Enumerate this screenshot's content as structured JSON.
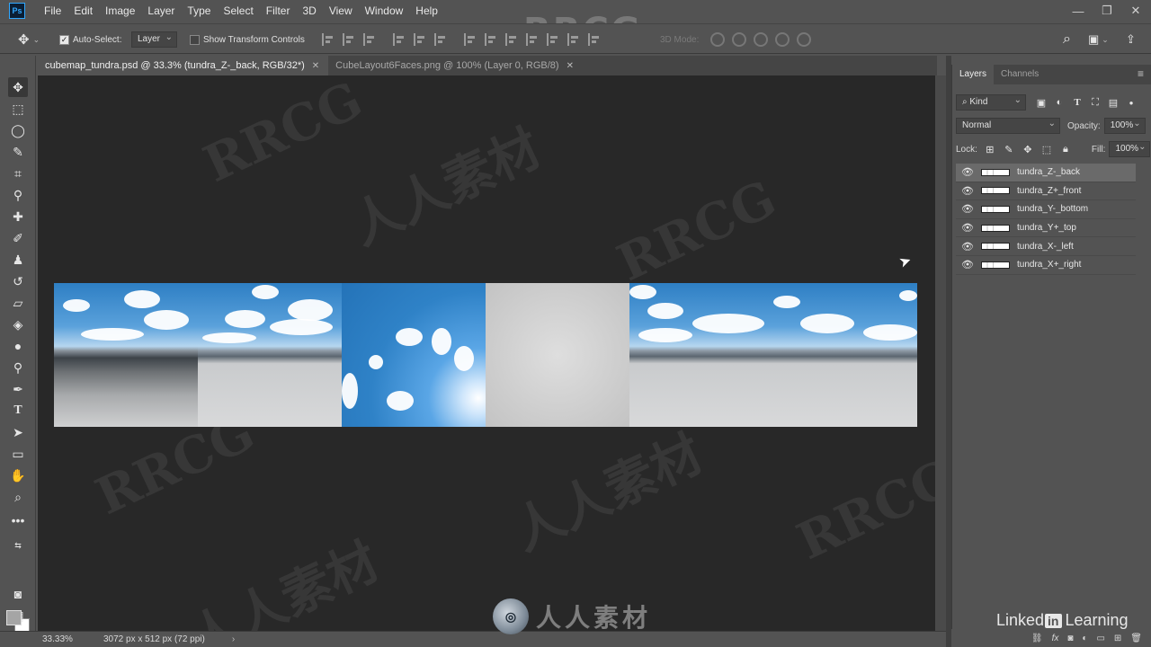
{
  "menu": [
    "File",
    "Edit",
    "Image",
    "Layer",
    "Type",
    "Select",
    "Filter",
    "3D",
    "View",
    "Window",
    "Help"
  ],
  "app_logo": "Ps",
  "options": {
    "auto_select_label": "Auto-Select:",
    "auto_select_value": "Layer",
    "show_transform_label": "Show Transform Controls",
    "mode_3d_label": "3D Mode:"
  },
  "tabs": [
    {
      "label": "cubemap_tundra.psd @ 33.3% (tundra_Z-_back, RGB/32*)",
      "active": true
    },
    {
      "label": "CubeLayout6Faces.png @ 100% (Layer 0, RGB/8)",
      "active": false
    }
  ],
  "status": {
    "zoom": "33.33%",
    "doc_size": "3072 px x 512 px (72 ppi)"
  },
  "layers_panel": {
    "tabs": [
      "Layers",
      "Channels"
    ],
    "kind_label": "Kind",
    "blend_mode": "Normal",
    "opacity_label": "Opacity:",
    "opacity_value": "100%",
    "lock_label": "Lock:",
    "fill_label": "Fill:",
    "fill_value": "100%",
    "layers": [
      {
        "name": "tundra_Z-_back",
        "selected": true
      },
      {
        "name": "tundra_Z+_front",
        "selected": false
      },
      {
        "name": "tundra_Y-_bottom",
        "selected": false
      },
      {
        "name": "tundra_Y+_top",
        "selected": false
      },
      {
        "name": "tundra_X-_left",
        "selected": false
      },
      {
        "name": "tundra_X+_right",
        "selected": false
      }
    ]
  },
  "watermarks": {
    "top": "RRCG",
    "bottom": "人人素材",
    "brand_prefix": "Linked",
    "brand_in": "in",
    "brand_suffix": "Learning"
  }
}
